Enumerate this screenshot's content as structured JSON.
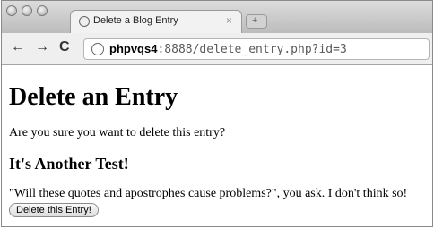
{
  "browser": {
    "tab_title": "Delete a Blog Entry",
    "tab_close": "×",
    "new_tab": "+",
    "url_host": "phpvqs4",
    "url_path": ":8888/delete_entry.php?id=3",
    "back_label": "←",
    "forward_label": "→",
    "reload_label": "C"
  },
  "page": {
    "heading": "Delete an Entry",
    "question": "Are you sure you want to delete this entry?",
    "entry_title": "It's Another Test!",
    "entry_body": "\"Will these quotes and apostrophes cause problems?\", you ask. I don't think so!",
    "delete_button": "Delete this Entry!"
  }
}
